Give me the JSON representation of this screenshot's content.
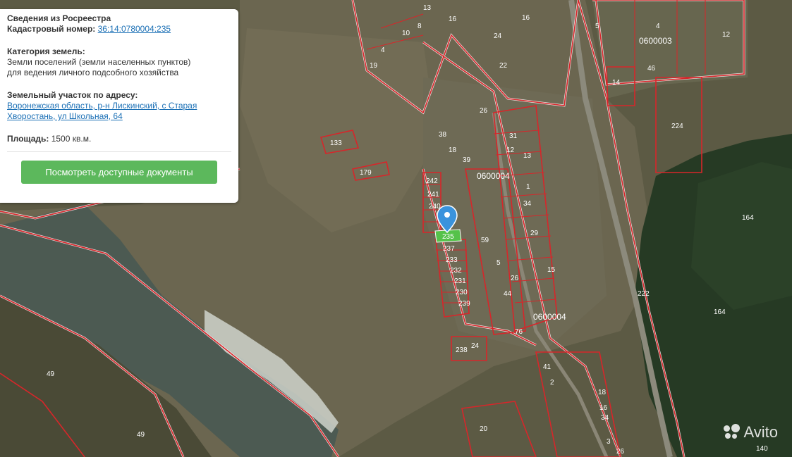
{
  "panel": {
    "title": "Сведения из Росреестра",
    "cadastral_label": "Кадастровый номер:",
    "cadastral_number": "36:14:0780004:235",
    "category_label": "Категория земель:",
    "category_line1": "Земли поселений (земли населенных пунктов)",
    "category_line2": "для ведения личного подсобного хозяйства",
    "address_label": "Земельный участок по адресу:",
    "address_line1": "Воронежская область, р-н Лискинский, с Старая",
    "address_line2": "Хворостань, ул Школьная, 64",
    "area_label": "Площадь:",
    "area_value": "1500 кв.м.",
    "docs_button": "Посмотреть доступные документы"
  },
  "map": {
    "quarters": [
      "0600003",
      "0600004",
      "0600004"
    ],
    "plot_numbers": [
      "19",
      "4",
      "10",
      "8",
      "13",
      "16",
      "24",
      "16",
      "22",
      "5",
      "4",
      "12",
      "14",
      "46",
      "224",
      "133",
      "179",
      "38",
      "18",
      "39",
      "26",
      "31",
      "12",
      "13",
      "1",
      "34",
      "242",
      "241",
      "240",
      "237",
      "233",
      "232",
      "231",
      "230",
      "239",
      "59",
      "29",
      "15",
      "44",
      "5",
      "26",
      "76",
      "24",
      "238",
      "222",
      "164",
      "164",
      "49",
      "49",
      "41",
      "2",
      "18",
      "16",
      "34",
      "3",
      "26",
      "140",
      "20"
    ],
    "selected_plot": "235"
  },
  "watermark": "Avito"
}
